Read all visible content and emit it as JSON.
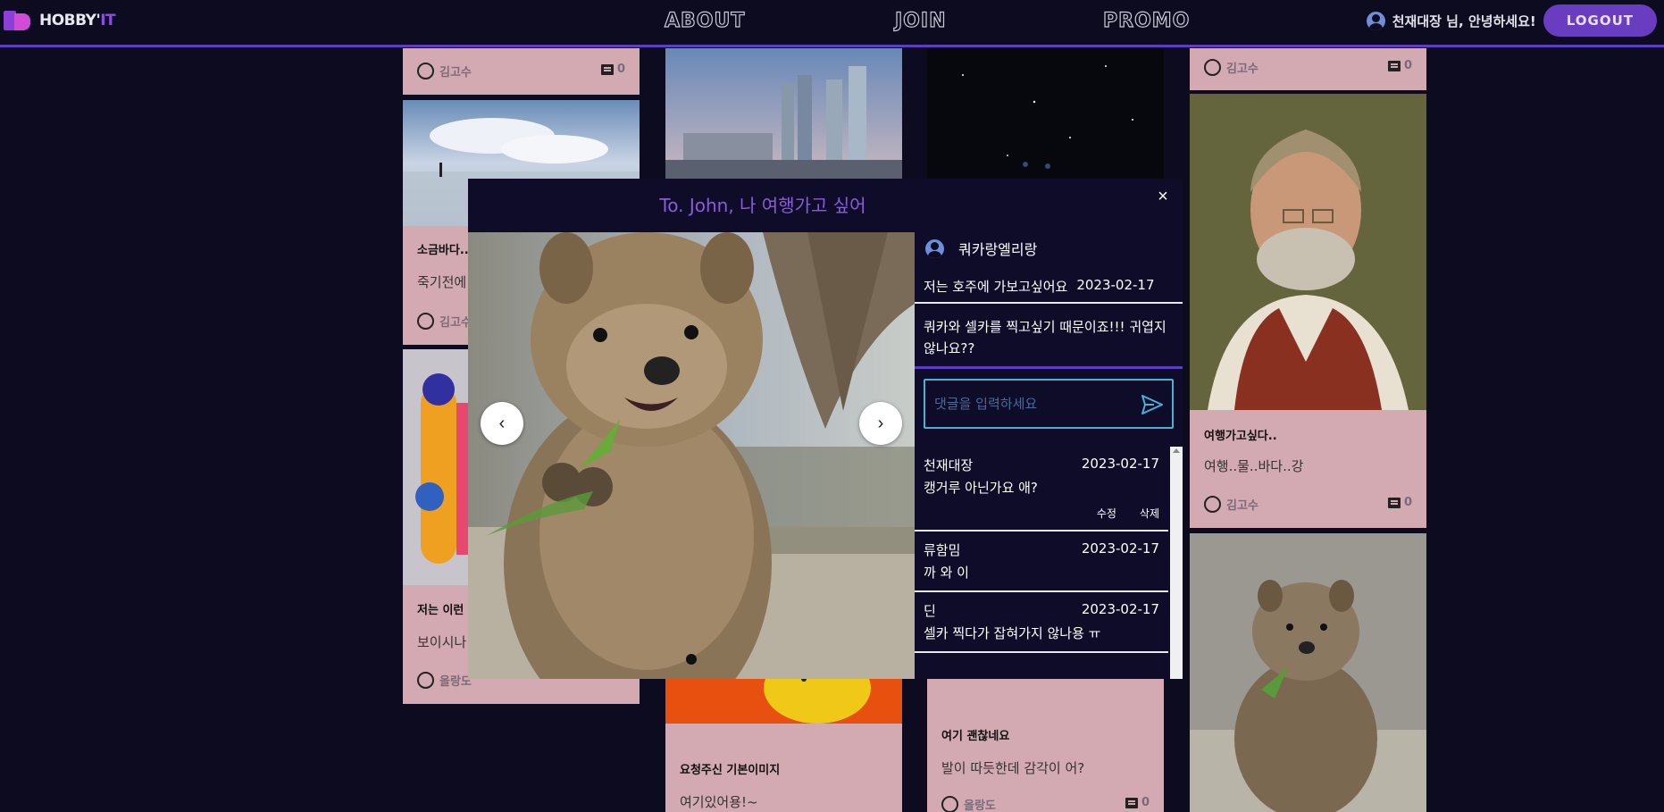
{
  "header": {
    "logo_text_main": "HOBBY'",
    "logo_text_accent": "IT",
    "nav": [
      "ABOUT",
      "JOIN",
      "PROMO"
    ],
    "greeting": "천재대장 님, 안녕하세요!",
    "logout_label": "LOGOUT"
  },
  "cards": {
    "c1": {
      "author": "김고수",
      "count": "0"
    },
    "c2": {
      "title": "소금바다..",
      "body": "죽기전에",
      "author": "김고수"
    },
    "c3": {
      "title": "저는 이런",
      "body": "보이시나",
      "author": "올랑도"
    },
    "c4": {
      "title": "요청주신 기본이미지",
      "body": "여기있어용!~"
    },
    "c5": {
      "title": "여기 괜찮네요",
      "body": "발이 따듯한데 감각이 어?",
      "author": "올랑도",
      "count": "0"
    },
    "c6": {
      "author": "김고수",
      "count": "0"
    },
    "c7": {
      "title": "여행가고싶다..",
      "body": "여행..물..바다..강",
      "author": "김고수",
      "count": "0"
    }
  },
  "modal": {
    "title": "To. John, 나 여행가고 싶어",
    "close_label": "×",
    "prev_label": "‹",
    "next_label": "›",
    "author": "쿼카랑엘리랑",
    "subtitle": "저는 호주에 가보고싶어요",
    "date": "2023-02-17",
    "body": "쿼카와 셀카를 찍고싶기 때문이죠!!! 귀엽지않나요??",
    "comment_placeholder": "댓글을 입력하세요",
    "comments": [
      {
        "author": "천재대장",
        "date": "2023-02-17",
        "text": "캥거루 아닌가요 애?",
        "edit": "수정",
        "delete": "삭제"
      },
      {
        "author": "류함밈",
        "date": "2023-02-17",
        "text": "까 와 이"
      },
      {
        "author": "딘",
        "date": "2023-02-17",
        "text": "셀카 찍다가 잡혀가지 않나용 ㅠ"
      }
    ]
  },
  "colors": {
    "accent": "#5b3fc0",
    "card_bg": "#d3a9b2",
    "page_bg": "#0d0b1f"
  }
}
